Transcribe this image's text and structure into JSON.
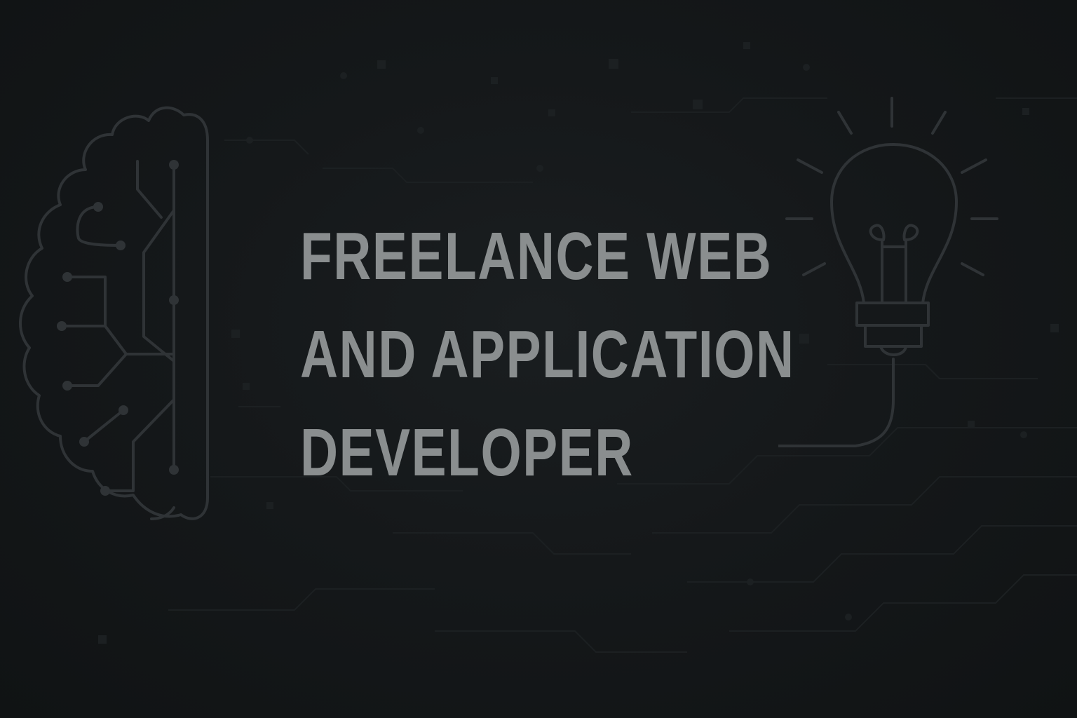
{
  "headline": {
    "line1": "FREELANCE WEB",
    "line2": "AND APPLICATION",
    "line3": "DEVELOPER"
  },
  "icons": {
    "left": "brain-circuit-icon",
    "right": "lightbulb-icon"
  },
  "colors": {
    "background": "#15181a",
    "text": "#8a8e8f",
    "line_art": "#2f3336"
  }
}
